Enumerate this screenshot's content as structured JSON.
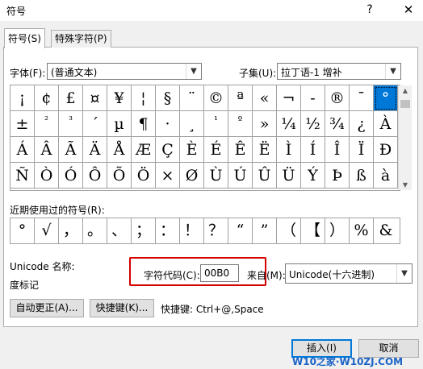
{
  "window": {
    "title": "符号",
    "help": "?",
    "close": "✕"
  },
  "tabs": [
    {
      "label": "符号(S)"
    },
    {
      "label": "特殊字符(P)"
    }
  ],
  "font": {
    "label": "字体(F):",
    "value": "(普通文本)"
  },
  "subset": {
    "label": "子集(U):",
    "value": "拉丁语-1 增补"
  },
  "grid_rows": [
    [
      "¡",
      "¢",
      "£",
      "¤",
      "¥",
      "¦",
      "§",
      "¨",
      "©",
      "ª",
      "«",
      "¬",
      "-",
      "®",
      "¯",
      "°"
    ],
    [
      "±",
      "²",
      "³",
      "´",
      "µ",
      "¶",
      "·",
      "¸",
      "¹",
      "º",
      "»",
      "¼",
      "½",
      "¾",
      "¿",
      "À"
    ],
    [
      "Á",
      "Â",
      "Ã",
      "Ä",
      "Å",
      "Æ",
      "Ç",
      "È",
      "É",
      "Ê",
      "Ë",
      "Ì",
      "Í",
      "Î",
      "Ï",
      "Ð"
    ],
    [
      "Ñ",
      "Ò",
      "Ó",
      "Ô",
      "Õ",
      "Ö",
      "×",
      "Ø",
      "Ù",
      "Ú",
      "Û",
      "Ü",
      "Ý",
      "Þ",
      "ß",
      "à"
    ]
  ],
  "selected_symbol": "°",
  "recent": {
    "label": "近期使用过的符号(R):",
    "symbols": [
      "°",
      "√",
      "，",
      "。",
      "、",
      "；",
      "：",
      "！",
      "？",
      "“",
      "”",
      "（",
      "【",
      "）",
      "%",
      "&"
    ]
  },
  "unicode_name": {
    "label": "Unicode 名称:",
    "value": "度标记"
  },
  "char_code": {
    "label": "字符代码(C):",
    "value": "00B0"
  },
  "from": {
    "label": "来自(M):",
    "value": "Unicode(十六进制)"
  },
  "buttons": {
    "autocorrect": "自动更正(A)...",
    "shortcut_key": "快捷键(K)...",
    "insert": "插入(I)",
    "cancel": "取消"
  },
  "shortcut_text": "快捷键: Ctrl+@,Space",
  "watermark": "W10之家·W10ZJ.COM",
  "colors": {
    "selection": "#0078d7",
    "highlight_box": "#d40000"
  }
}
